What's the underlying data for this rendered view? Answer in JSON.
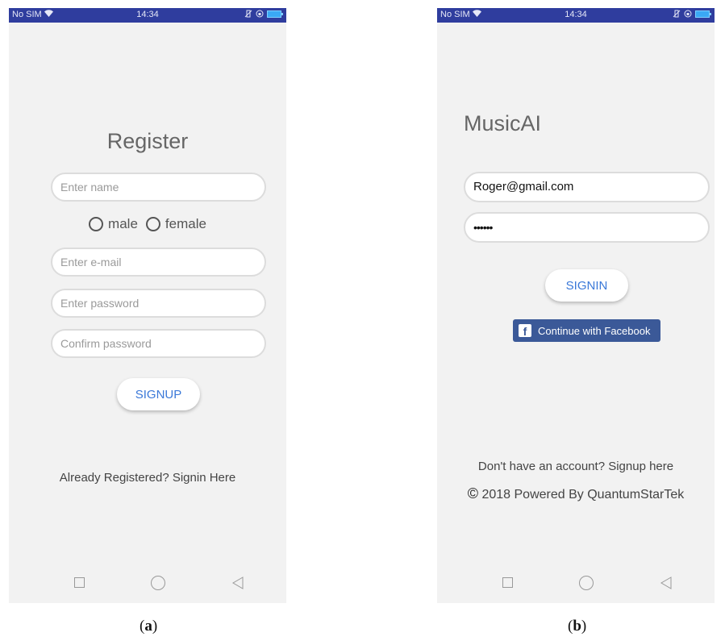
{
  "status_bar": {
    "carrier": "No SIM",
    "time": "14:34"
  },
  "panel_a": {
    "title": "Register",
    "name_placeholder": "Enter name",
    "gender_options": [
      "male",
      "female"
    ],
    "email_placeholder": "Enter e-mail",
    "password_placeholder": "Enter password",
    "confirm_placeholder": "Confirm password",
    "signup_label": "SIGNUP",
    "signin_link": "Already Registered? Signin Here",
    "caption": "a"
  },
  "panel_b": {
    "title": "MusicAI",
    "email_value": "Roger@gmail.com",
    "password_mask": "••••••",
    "signin_label": "SIGNIN",
    "facebook_label": "Continue with Facebook",
    "signup_link": "Don't have an account? Signup here",
    "footer_symbol": "©",
    "footer_text": "2018 Powered By QuantumStarTek",
    "caption": "b"
  },
  "colors": {
    "status_bar": "#2f3d9e",
    "accent_button_text": "#3a78d8",
    "facebook": "#3b5998",
    "screen_bg": "#f2f2f2"
  },
  "icons": [
    "wifi-icon",
    "vibrate-icon",
    "orientation-lock-icon",
    "battery-icon",
    "facebook-icon",
    "copyright-icon",
    "nav-recent-icon",
    "nav-home-icon",
    "nav-back-icon",
    "radio-button-icon"
  ]
}
